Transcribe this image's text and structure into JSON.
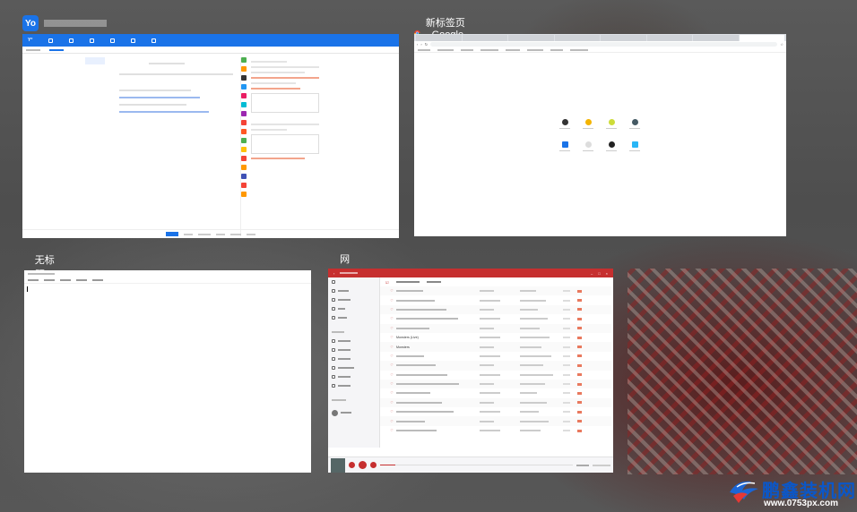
{
  "tiles": {
    "office": {
      "title": "",
      "icon_label": "Yo",
      "nav": [
        "",
        "",
        "",
        "",
        "",
        "",
        ""
      ],
      "subtabs": [
        "",
        ""
      ],
      "sidebar": [
        "",
        "",
        "",
        "",
        "",
        "",
        "",
        "",
        "",
        "",
        "",
        "",
        "",
        ""
      ],
      "footer": [
        "",
        "",
        "",
        "",
        "",
        "",
        ""
      ]
    },
    "chrome": {
      "title": "新标签页 - Google Chrome"
    },
    "notepad": {
      "title": "无标题 - 记事本"
    },
    "music": {
      "title": "网易云音乐",
      "rows": [
        {
          "num": "",
          "title": ""
        },
        {
          "num": "",
          "title": ""
        },
        {
          "num": "",
          "title": ""
        },
        {
          "num": "",
          "title": ""
        },
        {
          "num": "",
          "title": ""
        },
        {
          "num": "",
          "title": "Monsters (Live)"
        },
        {
          "num": "",
          "title": "Monsters"
        },
        {
          "num": "",
          "title": ""
        },
        {
          "num": "",
          "title": ""
        },
        {
          "num": "",
          "title": ""
        },
        {
          "num": "",
          "title": ""
        },
        {
          "num": "",
          "title": ""
        },
        {
          "num": "",
          "title": ""
        },
        {
          "num": "",
          "title": ""
        },
        {
          "num": "",
          "title": ""
        },
        {
          "num": "",
          "title": ""
        }
      ]
    }
  },
  "watermark": {
    "brand": "鹏鑫装机网",
    "url": "www.0753px.com"
  },
  "colors": {
    "office_blue": "#1a73e8",
    "netease_red": "#c62f2f",
    "chrome_tabbar": "#dee1e6",
    "watermark_blue": "#0b57c8"
  }
}
